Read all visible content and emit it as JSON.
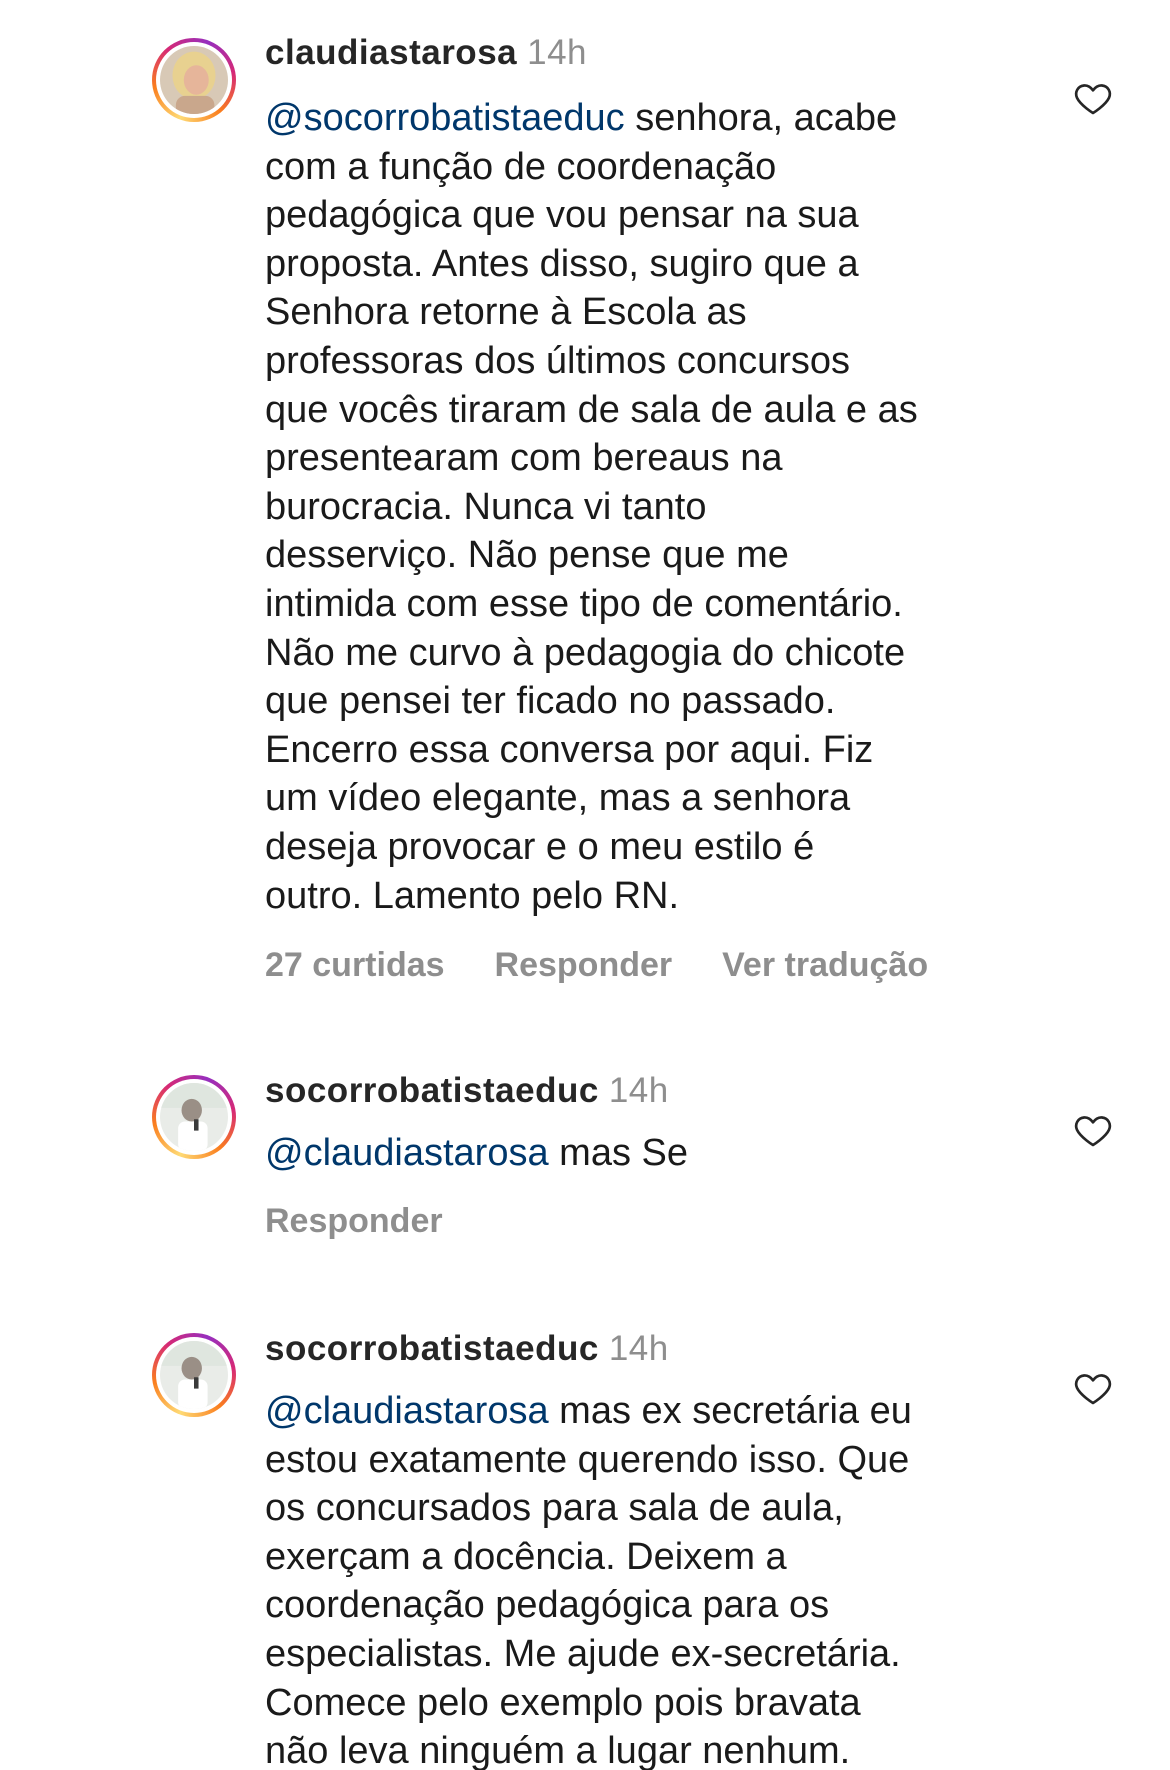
{
  "comments": [
    {
      "username": "claudiastarosa",
      "time": "14h",
      "mention": "@socorrobatistaeduc",
      "lines_first_rest": " senhora, acabe",
      "lines": [
        "com a função de coordenação",
        "pedagógica que vou pensar na sua",
        "proposta. Antes disso, sugiro que a",
        "Senhora retorne à Escola as",
        "professoras dos últimos concursos",
        "que vocês tiraram de sala de aula e as",
        "presentearam com bereaus na",
        "burocracia. Nunca vi tanto",
        "desserviço. Não pense que me",
        "intimida com esse tipo de comentário.",
        "Não me curvo à pedagogia do chicote",
        "que pensei ter ficado no passado.",
        "Encerro essa conversa por aqui. Fiz",
        "um vídeo elegante, mas a senhora",
        "deseja provocar e o meu estilo é",
        "outro. Lamento pelo RN."
      ],
      "likes": "27 curtidas",
      "reply": "Responder",
      "translate": "Ver tradução",
      "icon": "heart-outline-icon"
    },
    {
      "username": "socorrobatistaeduc",
      "time": "14h",
      "mention": "@claudiastarosa",
      "lines_first_rest": " mas Se",
      "lines": [],
      "reply": "Responder",
      "icon": "heart-outline-icon"
    },
    {
      "username": "socorrobatistaeduc",
      "time": "14h",
      "mention": "@claudiastarosa",
      "lines_first_rest": " mas ex secretária eu",
      "lines": [
        "estou exatamente querendo isso. Que",
        "os concursados para sala de aula,",
        "exerçam a docência. Deixem a",
        "coordenação pedagógica para os",
        "especialistas.  Me ajude ex-secretária.",
        "Comece pelo exemplo pois bravata",
        "não  leva ninguém a lugar nenhum."
      ],
      "icon": "heart-outline-icon"
    }
  ],
  "colors": {
    "mention": "#00376b",
    "secondary_text": "#8e8e8e",
    "primary_text": "#262626"
  }
}
